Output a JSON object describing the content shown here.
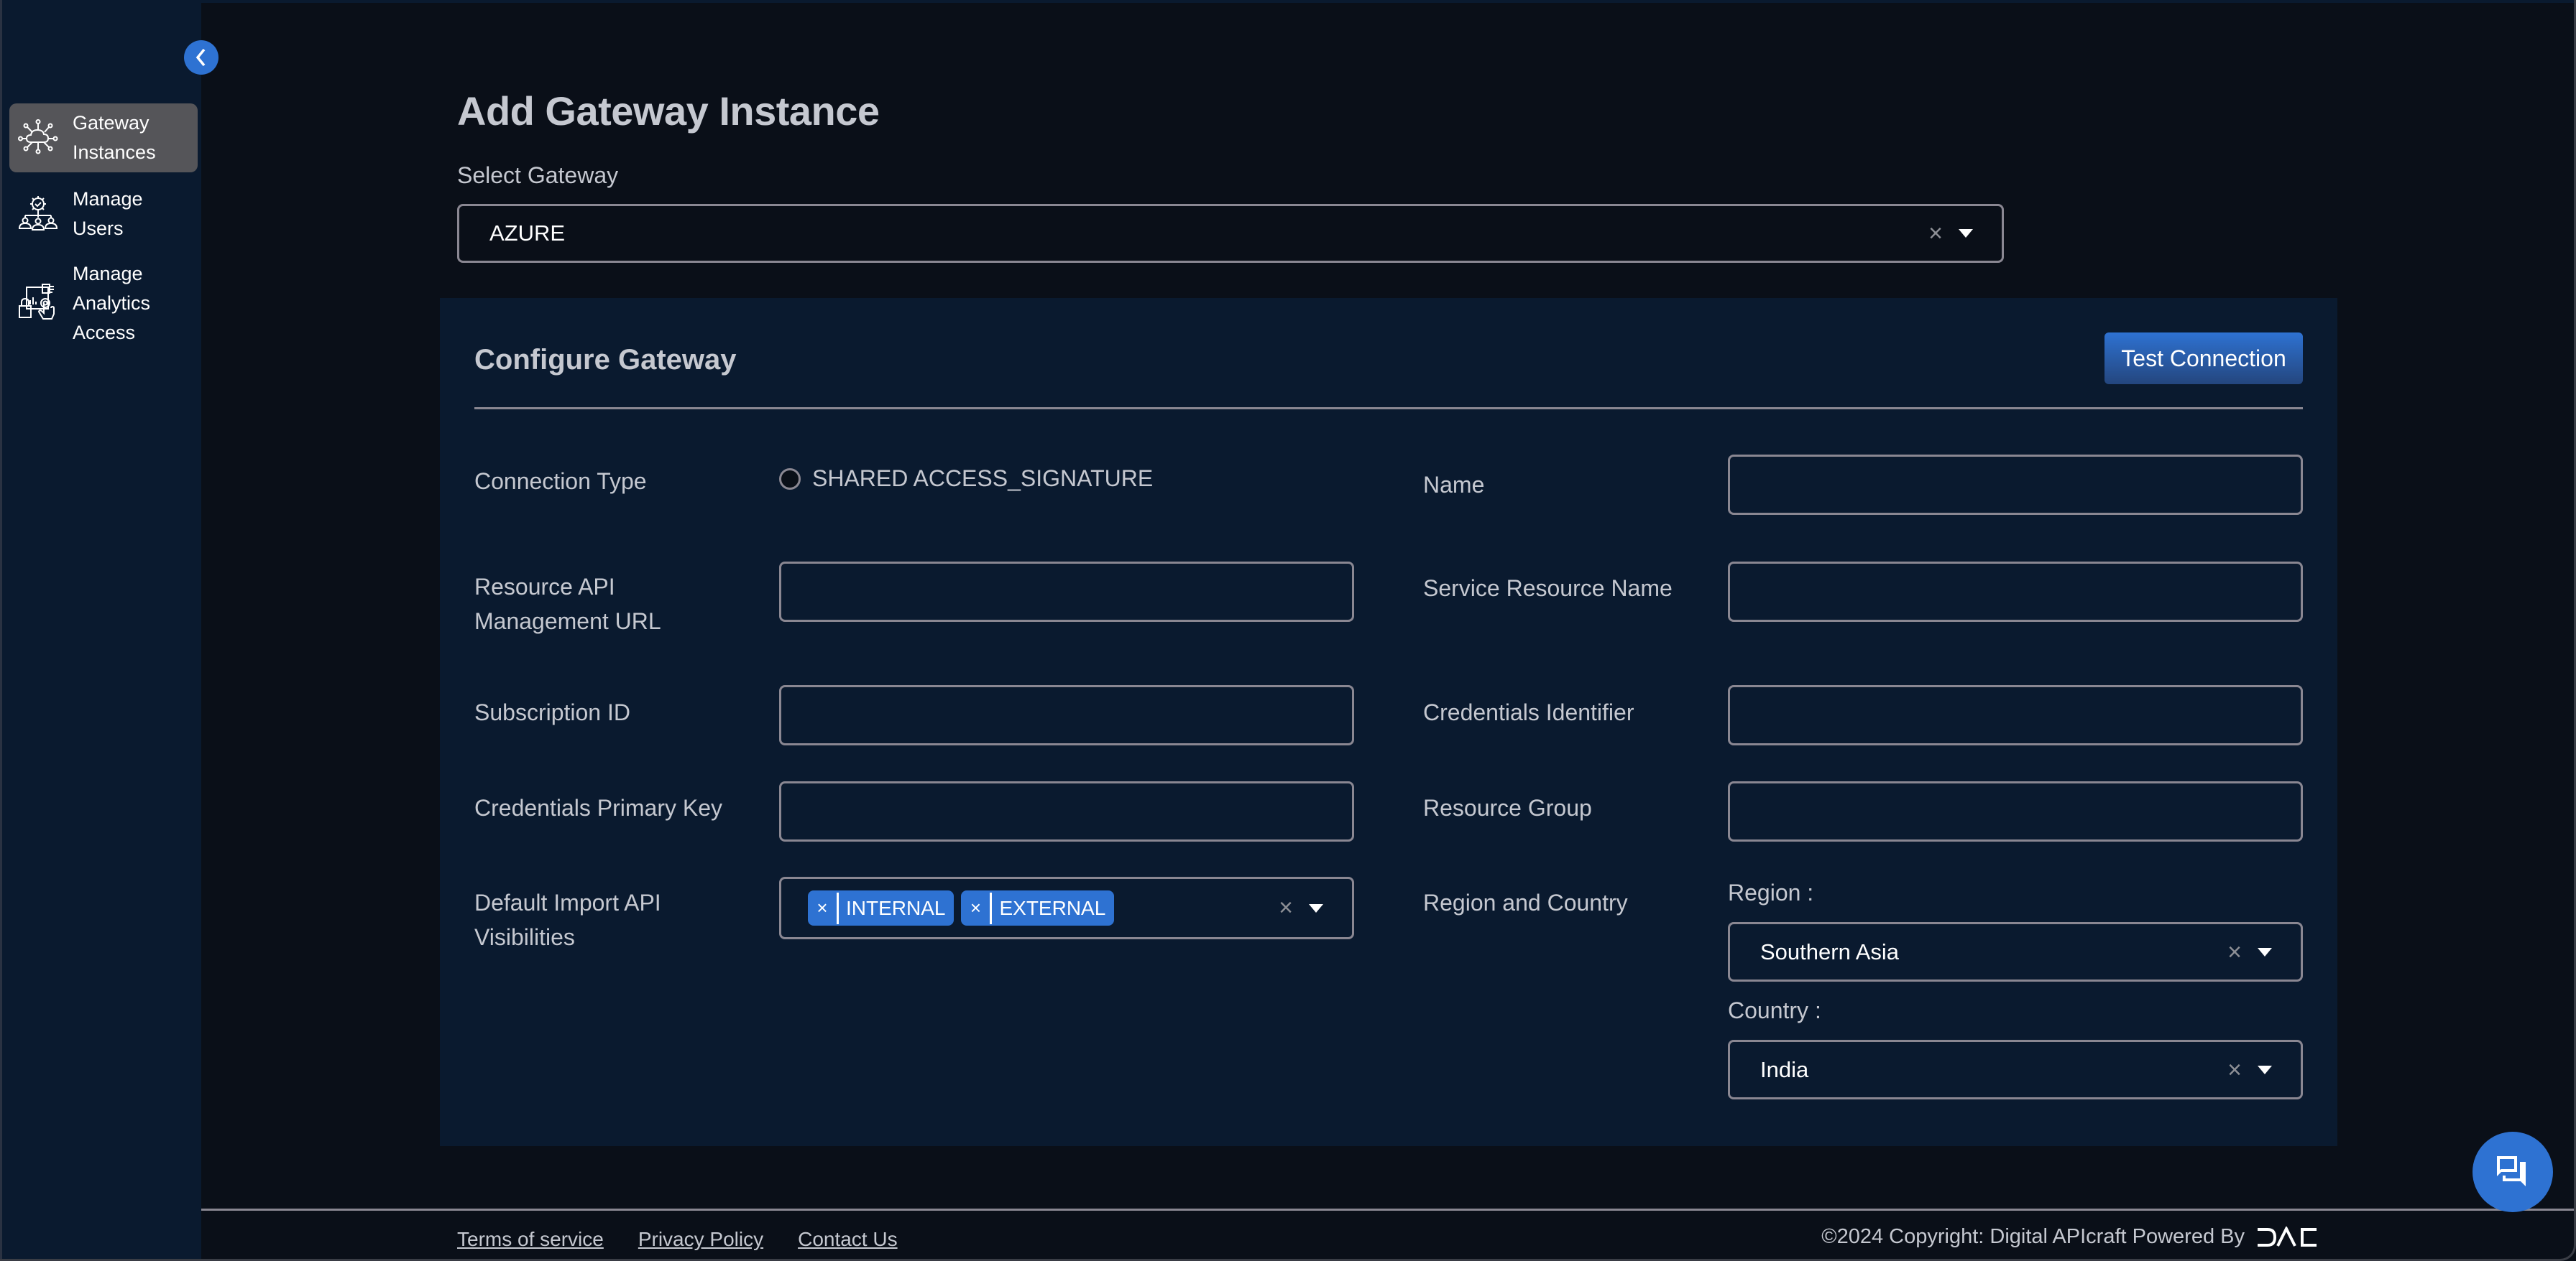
{
  "sidebar": {
    "collapse_icon": "chevron-left-icon",
    "items": [
      {
        "label": "Gateway Instances",
        "icon": "gateway-cloud-network-icon",
        "active": true
      },
      {
        "label": "Manage Users",
        "icon": "users-gear-icon",
        "active": false
      },
      {
        "label": "Manage Analytics Access",
        "icon": "analytics-access-icon",
        "active": false
      }
    ]
  },
  "page": {
    "title": "Add Gateway Instance",
    "select_gateway_label": "Select Gateway",
    "select_gateway_value": "AZURE"
  },
  "configure": {
    "title": "Configure Gateway",
    "test_connection_label": "Test Connection",
    "connection_type_label": "Connection Type",
    "connection_type_option": "SHARED ACCESS_SIGNATURE",
    "connection_type_selected": false,
    "fields": {
      "resource_api_url": {
        "label_line1": "Resource API",
        "label_line2": "Management URL",
        "value": ""
      },
      "subscription_id": {
        "label": "Subscription ID",
        "value": ""
      },
      "credentials_primary_key": {
        "label": "Credentials Primary Key",
        "value": ""
      },
      "default_import": {
        "label_line1": "Default Import API",
        "label_line2": "Visibilities",
        "tags": [
          "INTERNAL",
          "EXTERNAL"
        ]
      },
      "name": {
        "label": "Name",
        "value": ""
      },
      "service_resource_name": {
        "label": "Service Resource Name",
        "value": ""
      },
      "credentials_identifier": {
        "label": "Credentials Identifier",
        "value": ""
      },
      "resource_group": {
        "label": "Resource Group",
        "value": ""
      },
      "region_country": {
        "label": "Region and Country",
        "region_label": "Region :",
        "region_value": "Southern Asia",
        "country_label": "Country :",
        "country_value": "India"
      }
    },
    "clear_glyph": "×",
    "tag_remove_glyph": "×"
  },
  "footer": {
    "links": [
      "Terms of service",
      "Privacy Policy",
      "Contact Us"
    ],
    "copyright": "©2024 Copyright: Digital APIcraft Powered By",
    "brand_logo": "DAC"
  },
  "chat": {
    "icon": "chat-bubbles-icon"
  },
  "colors": {
    "accent": "#2e72d2",
    "sidebar_bg": "#0a1a2f",
    "main_bg": "#0a0f18",
    "panel_bg": "#0a1a2f",
    "active_item_bg": "#555559",
    "border": "#8a8792",
    "text": "#c5c8d0"
  }
}
